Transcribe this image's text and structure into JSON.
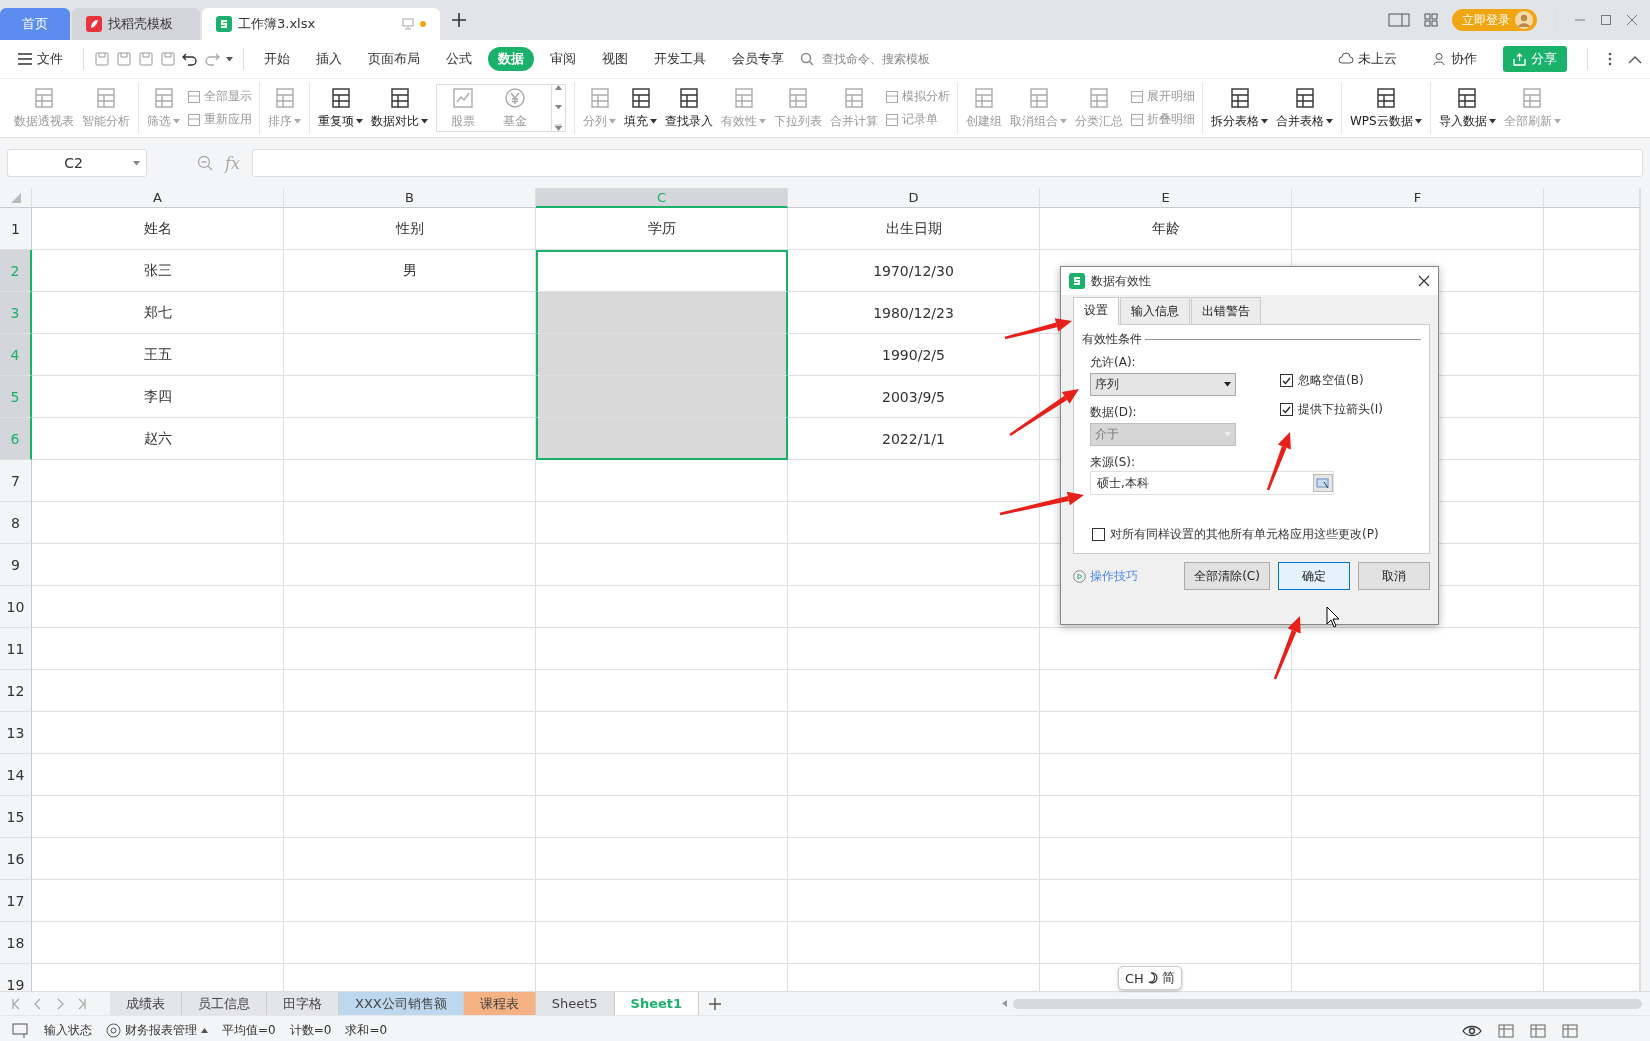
{
  "title_tabs": [
    {
      "kind": "home",
      "label": "首页",
      "selected": false
    },
    {
      "kind": "template",
      "label": "找稻壳模板",
      "selected": false
    },
    {
      "kind": "sheet",
      "label": "工作簿3.xlsx",
      "selected": true
    }
  ],
  "login": {
    "label": "立即登录"
  },
  "menu": {
    "file": "文件",
    "tabs": [
      {
        "label": "开始",
        "selected": false
      },
      {
        "label": "插入",
        "selected": false
      },
      {
        "label": "页面布局",
        "selected": false
      },
      {
        "label": "公式",
        "selected": false
      },
      {
        "label": "数据",
        "selected": true
      },
      {
        "label": "审阅",
        "selected": false
      },
      {
        "label": "视图",
        "selected": false
      },
      {
        "label": "开发工具",
        "selected": false
      },
      {
        "label": "会员专享",
        "selected": false
      }
    ],
    "search_placeholder": "查找命令、搜索模板",
    "cloud": "未上云",
    "collab": "协作",
    "share": "分享"
  },
  "ribbon": [
    {
      "items": [
        {
          "kind": "large",
          "label": "数据透视表",
          "disabled": true,
          "dropdown": false
        },
        {
          "kind": "large",
          "label": "智能分析",
          "disabled": true,
          "dropdown": false
        }
      ]
    },
    {
      "items": [
        {
          "kind": "large",
          "label": "筛选",
          "disabled": true,
          "dropdown": true
        },
        {
          "kind": "stack",
          "children": [
            {
              "label": "全部显示",
              "disabled": true
            },
            {
              "label": "重新应用",
              "disabled": true
            }
          ]
        }
      ]
    },
    {
      "items": [
        {
          "kind": "large",
          "label": "排序",
          "disabled": true,
          "dropdown": true
        }
      ]
    },
    {
      "items": [
        {
          "kind": "large",
          "label": "重复项",
          "disabled": false,
          "dropdown": true
        },
        {
          "kind": "large",
          "label": "数据对比",
          "disabled": false,
          "dropdown": true
        },
        {
          "kind": "gallery",
          "children": [
            {
              "label": "股票",
              "disabled": true
            },
            {
              "label": "基金",
              "disabled": true
            }
          ]
        }
      ]
    },
    {
      "items": [
        {
          "kind": "large",
          "label": "分列",
          "disabled": true,
          "dropdown": true
        },
        {
          "kind": "large",
          "label": "填充",
          "disabled": false,
          "dropdown": true
        },
        {
          "kind": "large",
          "label": "查找录入",
          "disabled": false,
          "dropdown": false
        },
        {
          "kind": "large",
          "label": "有效性",
          "disabled": true,
          "dropdown": true
        },
        {
          "kind": "large",
          "label": "下拉列表",
          "disabled": true,
          "dropdown": false
        },
        {
          "kind": "large",
          "label": "合并计算",
          "disabled": true,
          "dropdown": false
        },
        {
          "kind": "stack",
          "children": [
            {
              "label": "模拟分析",
              "disabled": true
            },
            {
              "label": "记录单",
              "disabled": true
            }
          ]
        }
      ]
    },
    {
      "items": [
        {
          "kind": "large",
          "label": "创建组",
          "disabled": true,
          "dropdown": false
        },
        {
          "kind": "large",
          "label": "取消组合",
          "disabled": true,
          "dropdown": true
        },
        {
          "kind": "large",
          "label": "分类汇总",
          "disabled": true,
          "dropdown": false
        },
        {
          "kind": "stack",
          "children": [
            {
              "label": "展开明细",
              "disabled": true
            },
            {
              "label": "折叠明细",
              "disabled": true
            }
          ]
        }
      ]
    },
    {
      "items": [
        {
          "kind": "large",
          "label": "拆分表格",
          "disabled": false,
          "dropdown": true
        },
        {
          "kind": "large",
          "label": "合并表格",
          "disabled": false,
          "dropdown": true
        }
      ]
    },
    {
      "items": [
        {
          "kind": "large",
          "label": "WPS云数据",
          "disabled": false,
          "dropdown": true
        }
      ]
    },
    {
      "items": [
        {
          "kind": "large",
          "label": "导入数据",
          "disabled": false,
          "dropdown": true
        },
        {
          "kind": "large",
          "label": "全部刷新",
          "disabled": true,
          "dropdown": true
        }
      ]
    }
  ],
  "formula_bar": {
    "name_box": "C2",
    "fx_label": "fx"
  },
  "sheet": {
    "columns": [
      {
        "label": "A",
        "selected": false
      },
      {
        "label": "B",
        "selected": false
      },
      {
        "label": "C",
        "selected": true
      },
      {
        "label": "D",
        "selected": false
      },
      {
        "label": "E",
        "selected": false
      },
      {
        "label": "F",
        "selected": false
      }
    ],
    "rows": [
      {
        "header": "1",
        "selected": false,
        "cells": [
          {
            "text": "姓名",
            "selected": false
          },
          {
            "text": "性别",
            "selected": false
          },
          {
            "text": "学历",
            "selected": false
          },
          {
            "text": "出生日期",
            "selected": false
          },
          {
            "text": "年龄",
            "selected": false
          },
          {
            "selected": false
          }
        ]
      },
      {
        "header": "2",
        "selected": true,
        "cells": [
          {
            "text": "张三",
            "selected": false
          },
          {
            "text": "男",
            "selected": false
          },
          {
            "selected": true
          },
          {
            "text": "1970/12/30",
            "selected": false
          },
          {
            "selected": false
          },
          {
            "selected": false
          }
        ]
      },
      {
        "header": "3",
        "selected": true,
        "cells": [
          {
            "text": "郑七",
            "selected": false
          },
          {
            "selected": false
          },
          {
            "selected": true
          },
          {
            "text": "1980/12/23",
            "selected": false
          },
          {
            "selected": false
          },
          {
            "selected": false
          }
        ]
      },
      {
        "header": "4",
        "selected": true,
        "cells": [
          {
            "text": "王五",
            "selected": false
          },
          {
            "selected": false
          },
          {
            "selected": true
          },
          {
            "text": "1990/2/5",
            "selected": false
          },
          {
            "selected": false
          },
          {
            "selected": false
          }
        ]
      },
      {
        "header": "5",
        "selected": true,
        "cells": [
          {
            "text": "李四",
            "selected": false
          },
          {
            "selected": false
          },
          {
            "selected": true
          },
          {
            "text": "2003/9/5",
            "selected": false
          },
          {
            "selected": false
          },
          {
            "selected": false
          }
        ]
      },
      {
        "header": "6",
        "selected": true,
        "cells": [
          {
            "text": "赵六",
            "selected": false
          },
          {
            "selected": false
          },
          {
            "selected": true
          },
          {
            "text": "2022/1/1",
            "selected": false
          },
          {
            "selected": false
          },
          {
            "selected": false
          }
        ]
      },
      {
        "header": "7",
        "selected": false
      },
      {
        "header": "8",
        "selected": false
      },
      {
        "header": "9",
        "selected": false
      },
      {
        "header": "10",
        "selected": false
      },
      {
        "header": "11",
        "selected": false
      },
      {
        "header": "12",
        "selected": false
      },
      {
        "header": "13",
        "selected": false
      },
      {
        "header": "14",
        "selected": false
      },
      {
        "header": "15",
        "selected": false
      },
      {
        "header": "16",
        "selected": false
      },
      {
        "header": "17",
        "selected": false
      },
      {
        "header": "18",
        "selected": false
      },
      {
        "header": "19",
        "selected": false
      }
    ]
  },
  "sheet_tabs": [
    {
      "label": "成绩表",
      "selected": false
    },
    {
      "label": "员工信息",
      "selected": false
    },
    {
      "label": "田字格",
      "selected": false
    },
    {
      "label": "XXX公司销售额",
      "selected": false,
      "color": "#bdd7ee"
    },
    {
      "label": "课程表",
      "selected": false,
      "color": "#f4b183"
    },
    {
      "label": "Sheet5",
      "selected": false
    },
    {
      "label": "Sheet1",
      "selected": true
    }
  ],
  "status_bar": {
    "mode": "输入状态",
    "finance": "财务报表管理",
    "stats": [
      "平均值=0",
      "计数=0",
      "求和=0"
    ]
  },
  "dialog": {
    "title": "数据有效性",
    "tabs": [
      {
        "label": "设置",
        "selected": true
      },
      {
        "label": "输入信息",
        "selected": false
      },
      {
        "label": "出错警告",
        "selected": false
      }
    ],
    "group_title": "有效性条件",
    "allow_label": "允许(A):",
    "allow_value": "序列",
    "data_label": "数据(D):",
    "data_value": "介于",
    "data_disabled": true,
    "source_label": "来源(S):",
    "source_value": "硕士,本科",
    "checkboxes": [
      {
        "label": "忽略空值(B)",
        "checked": true
      },
      {
        "label": "提供下拉箭头(I)",
        "checked": true
      },
      {
        "label": "对所有同样设置的其他所有单元格应用这些更改(P)",
        "checked": false
      }
    ],
    "tips_link": "操作技巧",
    "buttons": [
      {
        "label": "全部清除(C)",
        "selected": false
      },
      {
        "label": "确定",
        "selected": true
      },
      {
        "label": "取消",
        "selected": false
      }
    ]
  },
  "ime": {
    "lang": "CH",
    "script": "简"
  }
}
